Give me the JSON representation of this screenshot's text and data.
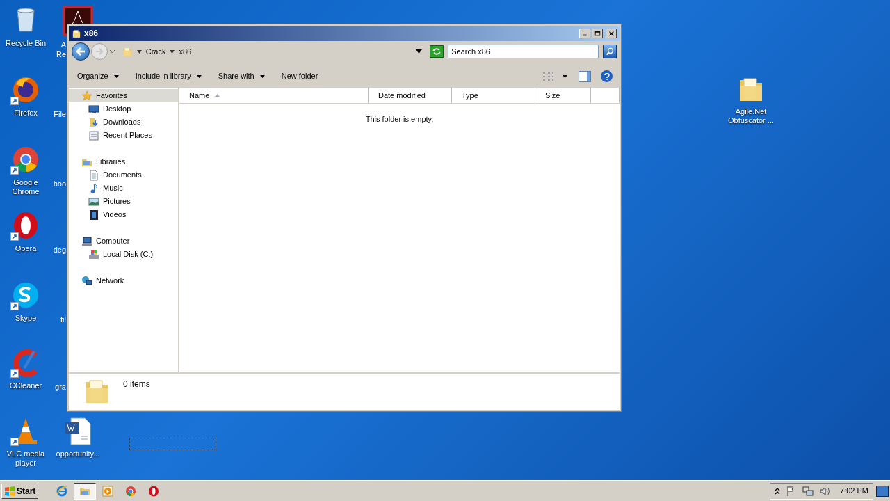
{
  "desktop_icons": [
    {
      "kind": "recycle",
      "lines": [
        "Recycle Bin"
      ]
    },
    {
      "kind": "firefox",
      "lines": [
        "Firefox"
      ]
    },
    {
      "kind": "chrome",
      "lines": [
        "Google",
        "Chrome"
      ]
    },
    {
      "kind": "opera",
      "lines": [
        "Opera"
      ]
    },
    {
      "kind": "skype",
      "lines": [
        "Skype"
      ]
    },
    {
      "kind": "ccleaner",
      "lines": [
        "CCleaner"
      ]
    },
    {
      "kind": "vlc",
      "lines": [
        "VLC media",
        "player"
      ]
    },
    {
      "kind": "acrobat",
      "lines": [
        "A",
        "Re"
      ]
    },
    {
      "kind": "hidden",
      "lines": [
        "File"
      ]
    },
    {
      "kind": "hidden",
      "lines": [
        "boo"
      ]
    },
    {
      "kind": "hidden",
      "lines": [
        "deg"
      ]
    },
    {
      "kind": "hidden",
      "lines": [
        "fil"
      ]
    },
    {
      "kind": "hidden",
      "lines": [
        "gra"
      ]
    },
    {
      "kind": "word",
      "lines": [
        "opportunity..."
      ]
    },
    {
      "kind": "folder",
      "lines": [
        "Agile.Net",
        "Obfuscator ..."
      ]
    }
  ],
  "window": {
    "title": "x86",
    "breadcrumb": [
      "Crack",
      "x86"
    ],
    "search": {
      "placeholder": "Search x86"
    },
    "toolbar": [
      {
        "label": "Organize",
        "dropdown": true
      },
      {
        "label": "Include in library",
        "dropdown": true
      },
      {
        "label": "Share with",
        "dropdown": true
      },
      {
        "label": "New folder",
        "dropdown": false
      }
    ],
    "nav": [
      {
        "label": "Favorites",
        "kind": "star",
        "selected": true,
        "children": [
          {
            "label": "Desktop",
            "kind": "desktop",
            "selected": false
          },
          {
            "label": "Downloads",
            "kind": "downloads",
            "selected": false
          },
          {
            "label": "Recent Places",
            "kind": "recent",
            "selected": false
          }
        ]
      },
      {
        "label": "Libraries",
        "kind": "libraries",
        "selected": false,
        "children": [
          {
            "label": "Documents",
            "kind": "documents",
            "selected": false
          },
          {
            "label": "Music",
            "kind": "music",
            "selected": false
          },
          {
            "label": "Pictures",
            "kind": "pictures",
            "selected": false
          },
          {
            "label": "Videos",
            "kind": "videos",
            "selected": false
          }
        ]
      },
      {
        "label": "Computer",
        "kind": "computer",
        "selected": false,
        "children": [
          {
            "label": "Local Disk (C:)",
            "kind": "disk",
            "selected": false
          }
        ]
      },
      {
        "label": "Network",
        "kind": "network",
        "selected": false
      }
    ],
    "columns": [
      {
        "label": "Name",
        "sorted": true
      },
      {
        "label": "Date modified",
        "sorted": false
      },
      {
        "label": "Type",
        "sorted": false
      },
      {
        "label": "Size",
        "sorted": false
      }
    ],
    "empty_message": "This folder is empty.",
    "status": "0 items"
  },
  "taskbar": {
    "start": "Start",
    "apps": [
      {
        "kind": "ie",
        "selected": false
      },
      {
        "kind": "explorer",
        "selected": true
      },
      {
        "kind": "media",
        "selected": false
      },
      {
        "kind": "chrome",
        "selected": false
      },
      {
        "kind": "opera",
        "selected": false
      }
    ],
    "clock": "7:02 PM"
  }
}
